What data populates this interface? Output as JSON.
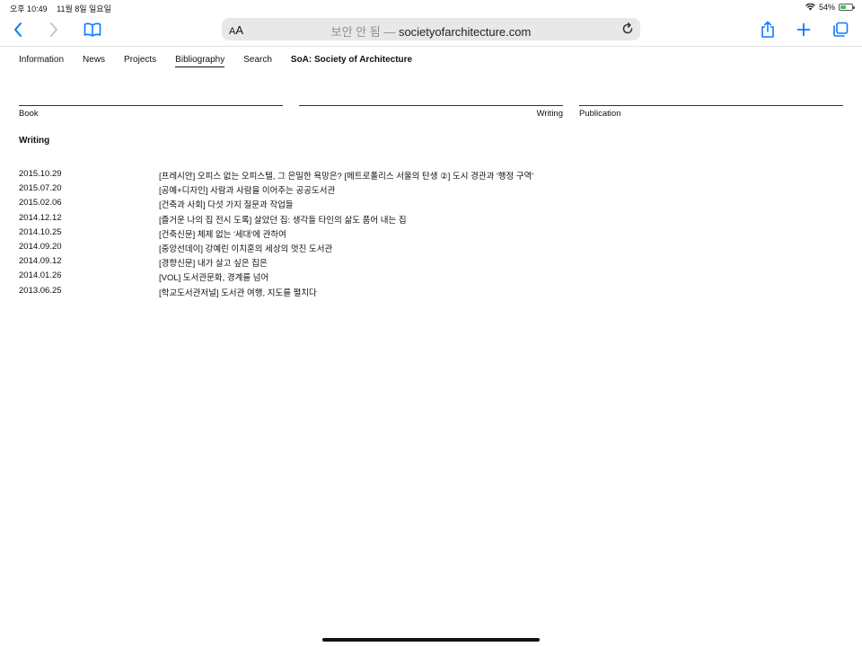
{
  "status_bar": {
    "time": "오후 10:49",
    "date": "11월 8일 일요일",
    "battery_text": "54%",
    "battery_level": 0.54
  },
  "toolbar": {
    "text_size_label_small": "A",
    "text_size_label_big": "A",
    "address_prefix": "보안 안 됨 — ",
    "address_domain": "societyofarchitecture.com"
  },
  "site_nav": {
    "items": [
      "Information",
      "News",
      "Projects",
      "Bibliography",
      "Search"
    ],
    "brand": "SoA: Society of Architecture"
  },
  "categories": [
    "Book",
    "Writing",
    "Publication"
  ],
  "section_title": "Writing",
  "entries": [
    {
      "date": "2015.10.29",
      "title": "[프레시안] 오피스 없는 오피스텔, 그 은밀한 욕망은? [메트로폴리스 서울의 탄생 ②] 도시 경관과 '행정 구역'"
    },
    {
      "date": "2015.07.20",
      "title": "[공예+디자인] 사람과 사람을 이어주는 공공도서관"
    },
    {
      "date": "2015.02.06",
      "title": "[건축과 사회] 다섯 가지 질문과 작업들"
    },
    {
      "date": "2014.12.12",
      "title": "[즐거운 나의 집 전시 도록] 살았던 집: 생각들 타인의 삶도 품어 내는 집"
    },
    {
      "date": "2014.10.25",
      "title": "[건축신문] 체제 없는 '세대'에 관하여"
    },
    {
      "date": "2014.09.20",
      "title": "[중앙선데이] 강예린 이치훈의 세상의 멋진 도서관"
    },
    {
      "date": "2014.09.12",
      "title": "[경향신문] 내가 살고 싶은 집은"
    },
    {
      "date": "2014.01.26",
      "title": "[VOL] 도서관문화, 경계를 넘어"
    },
    {
      "date": "2013.06.25",
      "title": "[학교도서관저널] 도서관 여행, 지도를 펼치다"
    }
  ],
  "icons": {
    "back": "chevron-left-icon",
    "forward": "chevron-right-icon",
    "bookmarks": "book-icon",
    "reload": "reload-icon",
    "share": "share-icon",
    "new_tab": "plus-icon",
    "tabs": "tabs-icon",
    "wifi": "wifi-icon",
    "battery": "battery-icon"
  },
  "colors": {
    "accent": "#0a7aff",
    "disabled": "#c7c7cc",
    "battery_fill": "#34c759"
  }
}
